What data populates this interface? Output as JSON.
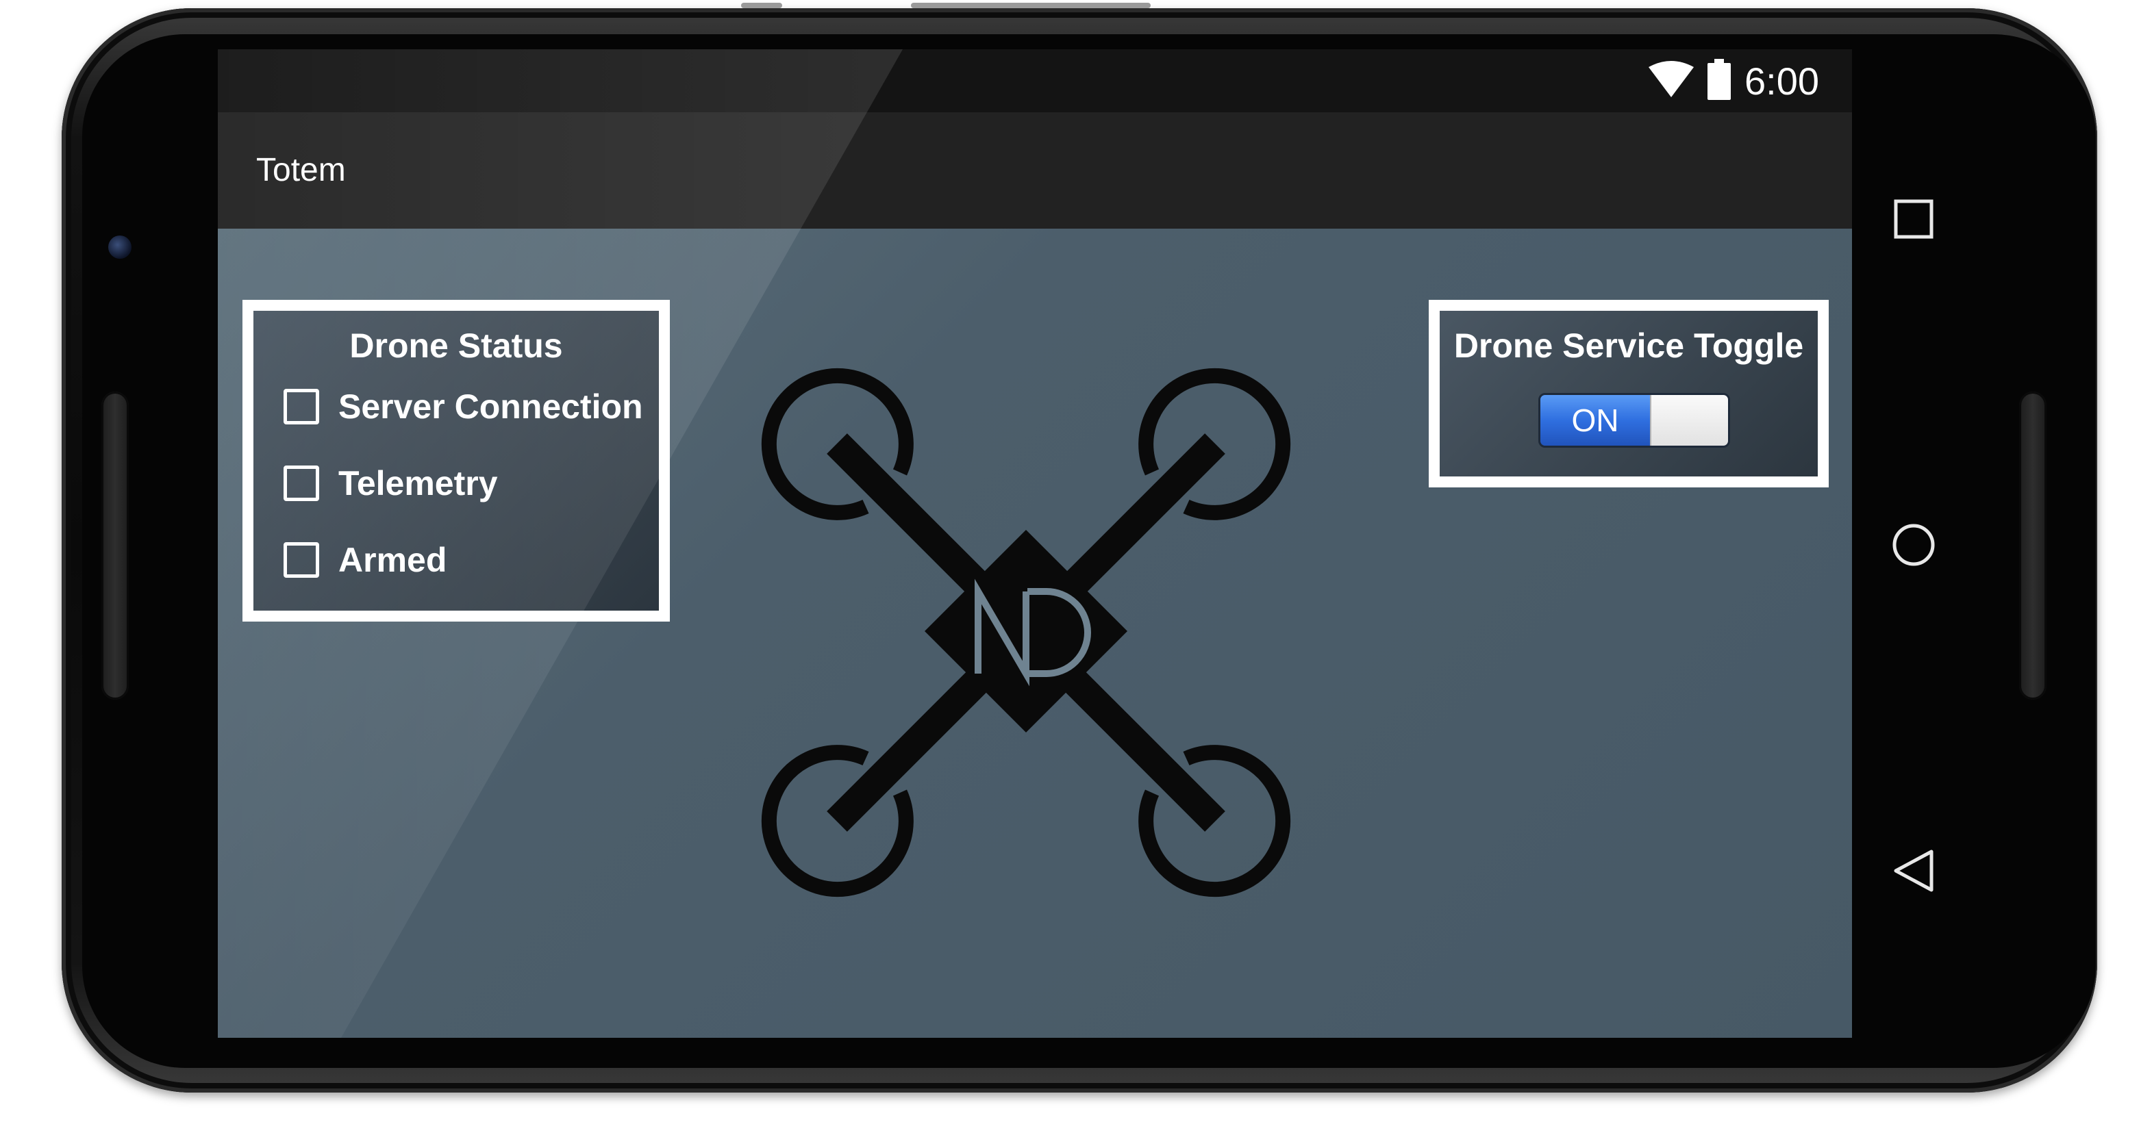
{
  "status_bar": {
    "time": "6:00",
    "icons": [
      "wifi-icon",
      "battery-icon"
    ]
  },
  "app": {
    "title": "Totem"
  },
  "drone_status": {
    "heading": "Drone Status",
    "items": [
      {
        "label": "Server Connection",
        "checked": false
      },
      {
        "label": "Telemetry",
        "checked": false
      },
      {
        "label": "Armed",
        "checked": false
      }
    ]
  },
  "service_toggle": {
    "heading": "Drone Service Toggle",
    "state_label": "ON",
    "is_on": true
  },
  "logo": {
    "text": "ND",
    "icon": "drone-logo"
  },
  "nav": {
    "icons": [
      "recents-icon",
      "home-icon",
      "back-icon"
    ]
  },
  "colors": {
    "content_bg": "#4c5e6b",
    "toggle_accent": "#2f6fe0",
    "panel_border": "#ffffff",
    "action_bar": "#222222"
  }
}
